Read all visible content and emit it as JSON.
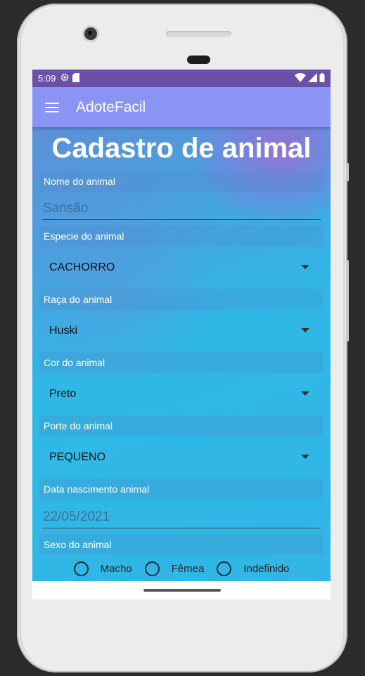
{
  "status": {
    "time": "5:09"
  },
  "appbar": {
    "title": "AdoteFacil"
  },
  "page": {
    "title": "Cadastro de animal"
  },
  "fields": {
    "nome": {
      "label": "Nome do animal",
      "value": "Sansão"
    },
    "especie": {
      "label": "Especie do animal",
      "value": "CACHORRO"
    },
    "raca": {
      "label": "Raça do animal",
      "value": "Huski"
    },
    "cor": {
      "label": "Cor do animal",
      "value": "Preto"
    },
    "porte": {
      "label": "Porte do animal",
      "value": "PEQUENO"
    },
    "nascimento": {
      "label": "Data nascimento animal",
      "value": "22/05/2021"
    },
    "sexo": {
      "label": "Sexo do animal",
      "options": [
        "Macho",
        "Fêmea",
        "Indefinido"
      ]
    }
  },
  "colors": {
    "status_bar": "#6a50a8",
    "app_bar": "#8a94f5",
    "accent_gradient_start": "#5d8fd8",
    "accent_gradient_end": "#2fb8e6"
  },
  "icons": [
    "menu-icon",
    "gear-icon",
    "sd-card-icon",
    "wifi-icon",
    "signal-icon",
    "battery-icon",
    "dropdown-caret-icon",
    "radio-icon"
  ]
}
